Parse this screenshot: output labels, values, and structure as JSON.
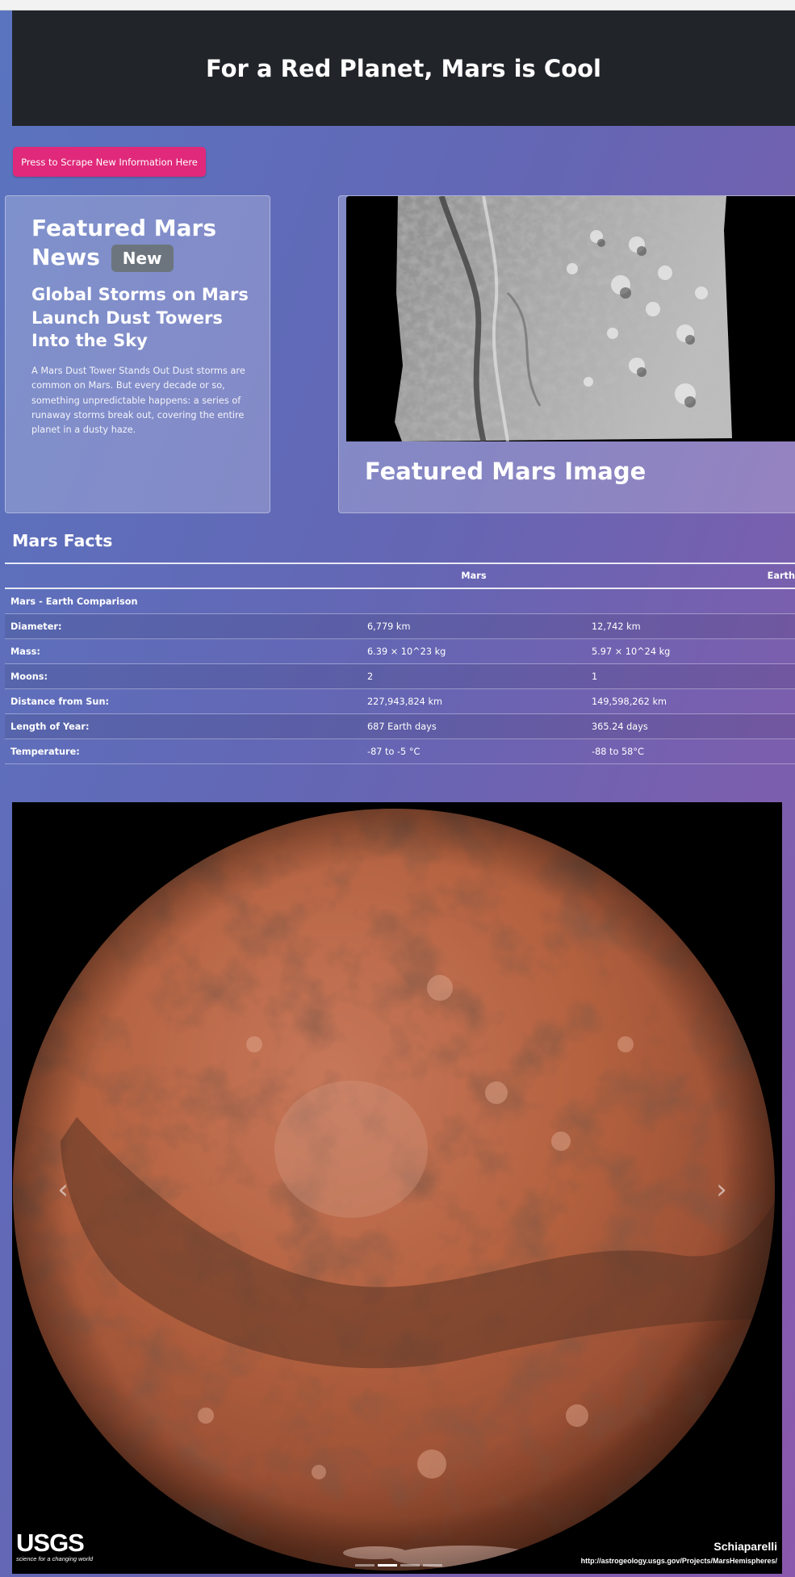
{
  "header": {
    "title": "For a Red Planet, Mars is Cool"
  },
  "scrape_button": {
    "label": "Press to Scrape New Information Here",
    "color": "#e0297a"
  },
  "news": {
    "heading": "Featured Mars News",
    "badge": "New",
    "title": "Global Storms on Mars Launch Dust Towers Into the Sky",
    "paragraph": "A Mars Dust Tower Stands Out Dust storms are common on Mars. But every decade or so, something unpredictable happens: a series of runaway storms break out, covering the entire planet in a dusty haze."
  },
  "featured_image": {
    "caption": "Featured Mars Image"
  },
  "facts": {
    "title": "Mars Facts",
    "columns": [
      "",
      "Mars",
      "Earth"
    ],
    "rows": [
      [
        "Mars - Earth Comparison",
        "",
        ""
      ],
      [
        "Diameter:",
        "6,779 km",
        "12,742 km"
      ],
      [
        "Mass:",
        "6.39 × 10^23 kg",
        "5.97 × 10^24 kg"
      ],
      [
        "Moons:",
        "2",
        "1"
      ],
      [
        "Distance from Sun:",
        "227,943,824 km",
        "149,598,262 km"
      ],
      [
        "Length of Year:",
        "687 Earth days",
        "365.24 days"
      ],
      [
        "Temperature:",
        "-87 to -5 °C",
        "-88 to 58°C"
      ]
    ]
  },
  "carousel": {
    "prev_icon": "chevron-left-icon",
    "next_icon": "chevron-right-icon",
    "slide_count": 4,
    "active_slide": 2,
    "logo": {
      "name": "USGS",
      "tagline": "science for a changing world"
    },
    "hemisphere_name": "Schiaparelli",
    "hemisphere_url": "http://astrogeology.usgs.gov/Projects/MarsHemispheres/"
  },
  "colors": {
    "header_bg": "#212429",
    "badge_bg": "#6c757d",
    "mars": "#b8653f"
  }
}
